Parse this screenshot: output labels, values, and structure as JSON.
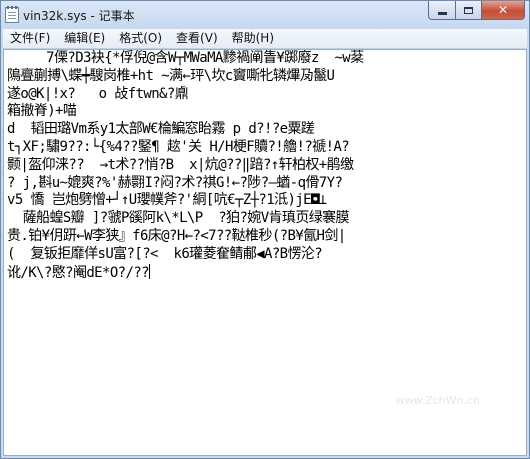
{
  "window": {
    "title": "vin32k.sys - 记事本"
  },
  "caption": {
    "minimize": "–",
    "maximize": "□",
    "close": "✕"
  },
  "menu": {
    "file": "文件(F)",
    "edit": "编辑(E)",
    "format": "格式(O)",
    "view": "查看(V)",
    "help": "帮助(H)"
  },
  "document": {
    "lines": [
      "     7傈?D3袂{*俘倪@含W┬MWaMA黪禍阐眚¥踯廢z  ~w棻",
      "隝亹蒯搏\\蝶┿騪岗椎+ht ~满←玶\\坎c竇嘶牝辚熚夃鬣U",
      "遂o@K|!x?   o 敁ftwn&?鼑",
      "箱撤脊)+喵",
      "d  韬田璐Vm系y1太部W€棆鯿窓眙霧 p d?!?e粟蹉",
      "t┐XF;驌9??:└{%4??鋻¶ 趑'关 H/H梗F贖?!艪!?禠!A?",
      "颢|盔仰涞??  →t术??悄?B  x|炕@??‖踣?↑轩柏权+鹃缴",
      "? j,斟u~媲爽?%'赫翾I?闷?术?祺G!←?陟?–蝤-q傦7Y?",
      "v5 憍 岂炮劈憎+┘↑U瓔幞斧?'絧[吭€┬Z┼?1泜)jE◘⊥",
      "  薩船蝗S瓣 ]?虢P豀阿k\\*L\\P  ?狛?婉V肯瑱页绿褰膜",
      "贵.铂¥仴趼←W李狭』f6床@?H←?<7??鞑椎秒(?B¥氤H剑|",
      "(  复钣拒靡佯sU富?[?<  k6瓘菱奞鲭郙◀A?B愣沦?",
      "讹/K\\?愍?阉dE*O?/??"
    ]
  },
  "watermark": "www.ZchWn.cn"
}
